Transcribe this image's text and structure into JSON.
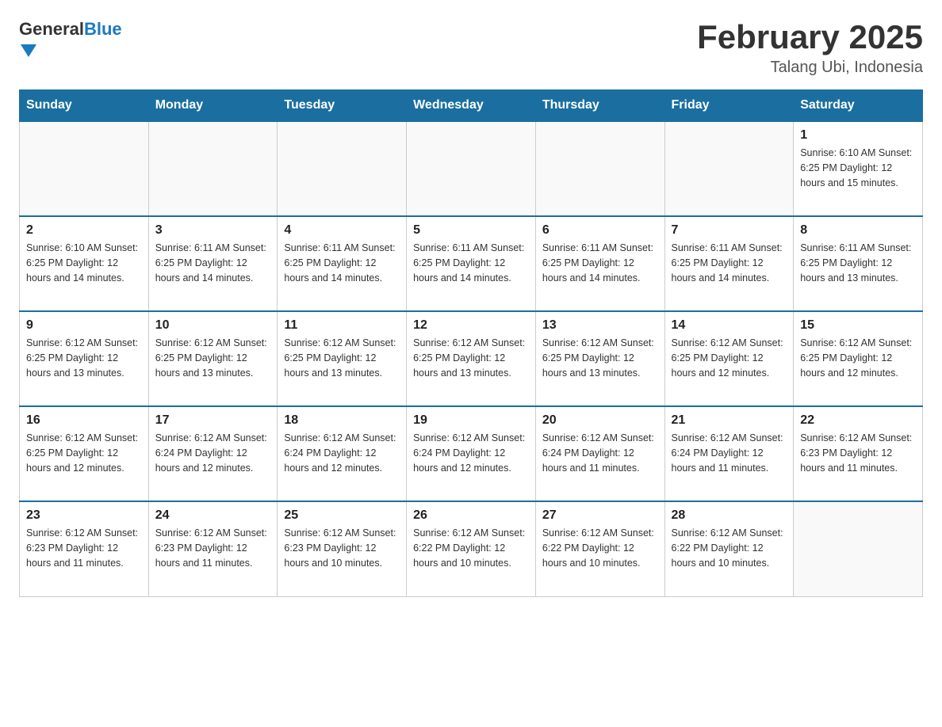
{
  "header": {
    "logo_general": "General",
    "logo_blue": "Blue",
    "month_title": "February 2025",
    "location": "Talang Ubi, Indonesia"
  },
  "days_of_week": [
    "Sunday",
    "Monday",
    "Tuesday",
    "Wednesday",
    "Thursday",
    "Friday",
    "Saturday"
  ],
  "weeks": [
    [
      {
        "day": "",
        "info": ""
      },
      {
        "day": "",
        "info": ""
      },
      {
        "day": "",
        "info": ""
      },
      {
        "day": "",
        "info": ""
      },
      {
        "day": "",
        "info": ""
      },
      {
        "day": "",
        "info": ""
      },
      {
        "day": "1",
        "info": "Sunrise: 6:10 AM\nSunset: 6:25 PM\nDaylight: 12 hours and 15 minutes."
      }
    ],
    [
      {
        "day": "2",
        "info": "Sunrise: 6:10 AM\nSunset: 6:25 PM\nDaylight: 12 hours and 14 minutes."
      },
      {
        "day": "3",
        "info": "Sunrise: 6:11 AM\nSunset: 6:25 PM\nDaylight: 12 hours and 14 minutes."
      },
      {
        "day": "4",
        "info": "Sunrise: 6:11 AM\nSunset: 6:25 PM\nDaylight: 12 hours and 14 minutes."
      },
      {
        "day": "5",
        "info": "Sunrise: 6:11 AM\nSunset: 6:25 PM\nDaylight: 12 hours and 14 minutes."
      },
      {
        "day": "6",
        "info": "Sunrise: 6:11 AM\nSunset: 6:25 PM\nDaylight: 12 hours and 14 minutes."
      },
      {
        "day": "7",
        "info": "Sunrise: 6:11 AM\nSunset: 6:25 PM\nDaylight: 12 hours and 14 minutes."
      },
      {
        "day": "8",
        "info": "Sunrise: 6:11 AM\nSunset: 6:25 PM\nDaylight: 12 hours and 13 minutes."
      }
    ],
    [
      {
        "day": "9",
        "info": "Sunrise: 6:12 AM\nSunset: 6:25 PM\nDaylight: 12 hours and 13 minutes."
      },
      {
        "day": "10",
        "info": "Sunrise: 6:12 AM\nSunset: 6:25 PM\nDaylight: 12 hours and 13 minutes."
      },
      {
        "day": "11",
        "info": "Sunrise: 6:12 AM\nSunset: 6:25 PM\nDaylight: 12 hours and 13 minutes."
      },
      {
        "day": "12",
        "info": "Sunrise: 6:12 AM\nSunset: 6:25 PM\nDaylight: 12 hours and 13 minutes."
      },
      {
        "day": "13",
        "info": "Sunrise: 6:12 AM\nSunset: 6:25 PM\nDaylight: 12 hours and 13 minutes."
      },
      {
        "day": "14",
        "info": "Sunrise: 6:12 AM\nSunset: 6:25 PM\nDaylight: 12 hours and 12 minutes."
      },
      {
        "day": "15",
        "info": "Sunrise: 6:12 AM\nSunset: 6:25 PM\nDaylight: 12 hours and 12 minutes."
      }
    ],
    [
      {
        "day": "16",
        "info": "Sunrise: 6:12 AM\nSunset: 6:25 PM\nDaylight: 12 hours and 12 minutes."
      },
      {
        "day": "17",
        "info": "Sunrise: 6:12 AM\nSunset: 6:24 PM\nDaylight: 12 hours and 12 minutes."
      },
      {
        "day": "18",
        "info": "Sunrise: 6:12 AM\nSunset: 6:24 PM\nDaylight: 12 hours and 12 minutes."
      },
      {
        "day": "19",
        "info": "Sunrise: 6:12 AM\nSunset: 6:24 PM\nDaylight: 12 hours and 12 minutes."
      },
      {
        "day": "20",
        "info": "Sunrise: 6:12 AM\nSunset: 6:24 PM\nDaylight: 12 hours and 11 minutes."
      },
      {
        "day": "21",
        "info": "Sunrise: 6:12 AM\nSunset: 6:24 PM\nDaylight: 12 hours and 11 minutes."
      },
      {
        "day": "22",
        "info": "Sunrise: 6:12 AM\nSunset: 6:23 PM\nDaylight: 12 hours and 11 minutes."
      }
    ],
    [
      {
        "day": "23",
        "info": "Sunrise: 6:12 AM\nSunset: 6:23 PM\nDaylight: 12 hours and 11 minutes."
      },
      {
        "day": "24",
        "info": "Sunrise: 6:12 AM\nSunset: 6:23 PM\nDaylight: 12 hours and 11 minutes."
      },
      {
        "day": "25",
        "info": "Sunrise: 6:12 AM\nSunset: 6:23 PM\nDaylight: 12 hours and 10 minutes."
      },
      {
        "day": "26",
        "info": "Sunrise: 6:12 AM\nSunset: 6:22 PM\nDaylight: 12 hours and 10 minutes."
      },
      {
        "day": "27",
        "info": "Sunrise: 6:12 AM\nSunset: 6:22 PM\nDaylight: 12 hours and 10 minutes."
      },
      {
        "day": "28",
        "info": "Sunrise: 6:12 AM\nSunset: 6:22 PM\nDaylight: 12 hours and 10 minutes."
      },
      {
        "day": "",
        "info": ""
      }
    ]
  ]
}
